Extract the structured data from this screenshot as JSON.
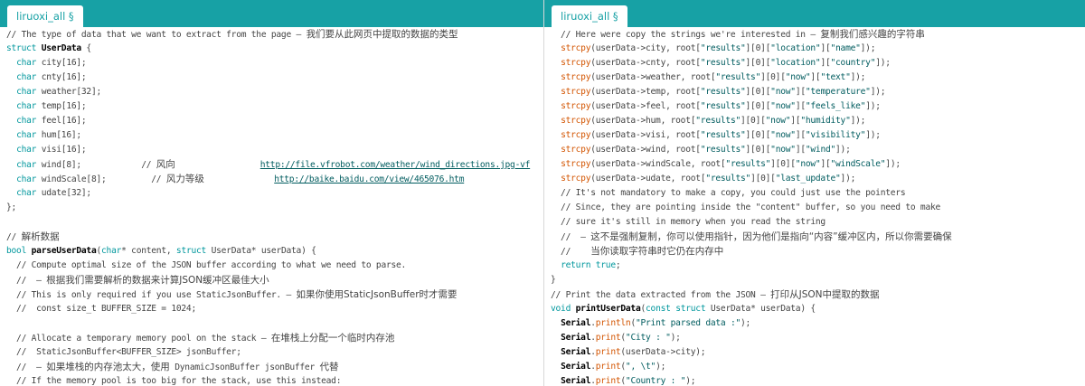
{
  "left_tab": {
    "label": "liruoxi_all §"
  },
  "right_tab": {
    "label": "liruoxi_all §"
  },
  "left_lines": [
    [
      {
        "t": "// The type of data that we want to extract from the page — ",
        "c": "c"
      },
      {
        "t": "我们要从此网页中提取的数据的类型",
        "c": "c cn"
      }
    ],
    [
      {
        "t": "struct",
        "c": "k"
      },
      {
        "t": " ",
        "c": "p"
      },
      {
        "t": "UserData",
        "c": "b"
      },
      {
        "t": " {",
        "c": "p"
      }
    ],
    [
      {
        "t": "  ",
        "c": "p"
      },
      {
        "t": "char",
        "c": "k"
      },
      {
        "t": " city[16];",
        "c": "p"
      }
    ],
    [
      {
        "t": "  ",
        "c": "p"
      },
      {
        "t": "char",
        "c": "k"
      },
      {
        "t": " cnty[16];",
        "c": "p"
      }
    ],
    [
      {
        "t": "  ",
        "c": "p"
      },
      {
        "t": "char",
        "c": "k"
      },
      {
        "t": " weather[32];",
        "c": "p"
      }
    ],
    [
      {
        "t": "  ",
        "c": "p"
      },
      {
        "t": "char",
        "c": "k"
      },
      {
        "t": " temp[16];",
        "c": "p"
      }
    ],
    [
      {
        "t": "  ",
        "c": "p"
      },
      {
        "t": "char",
        "c": "k"
      },
      {
        "t": " feel[16];",
        "c": "p"
      }
    ],
    [
      {
        "t": "  ",
        "c": "p"
      },
      {
        "t": "char",
        "c": "k"
      },
      {
        "t": " hum[16];",
        "c": "p"
      }
    ],
    [
      {
        "t": "  ",
        "c": "p"
      },
      {
        "t": "char",
        "c": "k"
      },
      {
        "t": " visi[16];",
        "c": "p"
      }
    ],
    [
      {
        "t": "  ",
        "c": "p"
      },
      {
        "t": "char",
        "c": "k"
      },
      {
        "t": " wind[8];            // ",
        "c": "p"
      },
      {
        "t": "风向",
        "c": "c cn"
      },
      {
        "t": "                 ",
        "c": "p"
      },
      {
        "t": "http://file.vfrobot.com/weather/wind_directions.jpg-vf",
        "c": "u"
      }
    ],
    [
      {
        "t": "  ",
        "c": "p"
      },
      {
        "t": "char",
        "c": "k"
      },
      {
        "t": " windScale[8];         // ",
        "c": "p"
      },
      {
        "t": "风力等级",
        "c": "c cn"
      },
      {
        "t": "              ",
        "c": "p"
      },
      {
        "t": "http://baike.baidu.com/view/465076.htm",
        "c": "u"
      }
    ],
    [
      {
        "t": "  ",
        "c": "p"
      },
      {
        "t": "char",
        "c": "k"
      },
      {
        "t": " udate[32];",
        "c": "p"
      }
    ],
    [
      {
        "t": "};",
        "c": "p"
      }
    ],
    [
      {
        "t": "",
        "c": "p"
      }
    ],
    [
      {
        "t": "// ",
        "c": "c"
      },
      {
        "t": "解析数据",
        "c": "c cn"
      }
    ],
    [
      {
        "t": "bool",
        "c": "k"
      },
      {
        "t": " ",
        "c": "p"
      },
      {
        "t": "parseUserData",
        "c": "b"
      },
      {
        "t": "(",
        "c": "p"
      },
      {
        "t": "char",
        "c": "k"
      },
      {
        "t": "* content, ",
        "c": "p"
      },
      {
        "t": "struct",
        "c": "k"
      },
      {
        "t": " UserData* userData) {",
        "c": "p"
      }
    ],
    [
      {
        "t": "  // Compute optimal size of the JSON buffer according to what we need to parse.",
        "c": "c"
      }
    ],
    [
      {
        "t": "  //  — ",
        "c": "c"
      },
      {
        "t": "根据我们需要解析的数据来计算JSON缓冲区最佳大小",
        "c": "c cn"
      }
    ],
    [
      {
        "t": "  // This is only required if you use StaticJsonBuffer. — ",
        "c": "c"
      },
      {
        "t": "如果你使用StaticJsonBuffer时才需要",
        "c": "c cn"
      }
    ],
    [
      {
        "t": "  //  const size_t BUFFER_SIZE = 1024;",
        "c": "c"
      }
    ],
    [
      {
        "t": "",
        "c": "p"
      }
    ],
    [
      {
        "t": "  // Allocate a temporary memory pool on the stack — ",
        "c": "c"
      },
      {
        "t": "在堆栈上分配一个临时内存池",
        "c": "c cn"
      }
    ],
    [
      {
        "t": "  //  StaticJsonBuffer<BUFFER_SIZE> jsonBuffer;",
        "c": "c"
      }
    ],
    [
      {
        "t": "  //  — ",
        "c": "c"
      },
      {
        "t": "如果堆栈的内存池太大，使用",
        "c": "c cn"
      },
      {
        "t": " DynamicJsonBuffer jsonBuffer ",
        "c": "c"
      },
      {
        "t": "代替",
        "c": "c cn"
      }
    ],
    [
      {
        "t": "  // If the memory pool is too big for the stack, use this instead:",
        "c": "c"
      }
    ]
  ],
  "right_lines": [
    [
      {
        "t": "  // Here were copy the strings we're interested in — ",
        "c": "c"
      },
      {
        "t": "复制我们感兴趣的字符串",
        "c": "c cn"
      }
    ],
    [
      {
        "t": "  ",
        "c": "p"
      },
      {
        "t": "strcpy",
        "c": "f"
      },
      {
        "t": "(userData->city, root[",
        "c": "p"
      },
      {
        "t": "\"results\"",
        "c": "s"
      },
      {
        "t": "][0][",
        "c": "p"
      },
      {
        "t": "\"location\"",
        "c": "s"
      },
      {
        "t": "][",
        "c": "p"
      },
      {
        "t": "\"name\"",
        "c": "s"
      },
      {
        "t": "]);",
        "c": "p"
      }
    ],
    [
      {
        "t": "  ",
        "c": "p"
      },
      {
        "t": "strcpy",
        "c": "f"
      },
      {
        "t": "(userData->cnty, root[",
        "c": "p"
      },
      {
        "t": "\"results\"",
        "c": "s"
      },
      {
        "t": "][0][",
        "c": "p"
      },
      {
        "t": "\"location\"",
        "c": "s"
      },
      {
        "t": "][",
        "c": "p"
      },
      {
        "t": "\"country\"",
        "c": "s"
      },
      {
        "t": "]);",
        "c": "p"
      }
    ],
    [
      {
        "t": "  ",
        "c": "p"
      },
      {
        "t": "strcpy",
        "c": "f"
      },
      {
        "t": "(userData->weather, root[",
        "c": "p"
      },
      {
        "t": "\"results\"",
        "c": "s"
      },
      {
        "t": "][0][",
        "c": "p"
      },
      {
        "t": "\"now\"",
        "c": "s"
      },
      {
        "t": "][",
        "c": "p"
      },
      {
        "t": "\"text\"",
        "c": "s"
      },
      {
        "t": "]);",
        "c": "p"
      }
    ],
    [
      {
        "t": "  ",
        "c": "p"
      },
      {
        "t": "strcpy",
        "c": "f"
      },
      {
        "t": "(userData->temp, root[",
        "c": "p"
      },
      {
        "t": "\"results\"",
        "c": "s"
      },
      {
        "t": "][0][",
        "c": "p"
      },
      {
        "t": "\"now\"",
        "c": "s"
      },
      {
        "t": "][",
        "c": "p"
      },
      {
        "t": "\"temperature\"",
        "c": "s"
      },
      {
        "t": "]);",
        "c": "p"
      }
    ],
    [
      {
        "t": "  ",
        "c": "p"
      },
      {
        "t": "strcpy",
        "c": "f"
      },
      {
        "t": "(userData->feel, root[",
        "c": "p"
      },
      {
        "t": "\"results\"",
        "c": "s"
      },
      {
        "t": "][0][",
        "c": "p"
      },
      {
        "t": "\"now\"",
        "c": "s"
      },
      {
        "t": "][",
        "c": "p"
      },
      {
        "t": "\"feels_like\"",
        "c": "s"
      },
      {
        "t": "]);",
        "c": "p"
      }
    ],
    [
      {
        "t": "  ",
        "c": "p"
      },
      {
        "t": "strcpy",
        "c": "f"
      },
      {
        "t": "(userData->hum, root[",
        "c": "p"
      },
      {
        "t": "\"results\"",
        "c": "s"
      },
      {
        "t": "][0][",
        "c": "p"
      },
      {
        "t": "\"now\"",
        "c": "s"
      },
      {
        "t": "][",
        "c": "p"
      },
      {
        "t": "\"humidity\"",
        "c": "s"
      },
      {
        "t": "]);",
        "c": "p"
      }
    ],
    [
      {
        "t": "  ",
        "c": "p"
      },
      {
        "t": "strcpy",
        "c": "f"
      },
      {
        "t": "(userData->visi, root[",
        "c": "p"
      },
      {
        "t": "\"results\"",
        "c": "s"
      },
      {
        "t": "][0][",
        "c": "p"
      },
      {
        "t": "\"now\"",
        "c": "s"
      },
      {
        "t": "][",
        "c": "p"
      },
      {
        "t": "\"visibility\"",
        "c": "s"
      },
      {
        "t": "]);",
        "c": "p"
      }
    ],
    [
      {
        "t": "  ",
        "c": "p"
      },
      {
        "t": "strcpy",
        "c": "f"
      },
      {
        "t": "(userData->wind, root[",
        "c": "p"
      },
      {
        "t": "\"results\"",
        "c": "s"
      },
      {
        "t": "][0][",
        "c": "p"
      },
      {
        "t": "\"now\"",
        "c": "s"
      },
      {
        "t": "][",
        "c": "p"
      },
      {
        "t": "\"wind\"",
        "c": "s"
      },
      {
        "t": "]);",
        "c": "p"
      }
    ],
    [
      {
        "t": "  ",
        "c": "p"
      },
      {
        "t": "strcpy",
        "c": "f"
      },
      {
        "t": "(userData->windScale, root[",
        "c": "p"
      },
      {
        "t": "\"results\"",
        "c": "s"
      },
      {
        "t": "][0][",
        "c": "p"
      },
      {
        "t": "\"now\"",
        "c": "s"
      },
      {
        "t": "][",
        "c": "p"
      },
      {
        "t": "\"windScale\"",
        "c": "s"
      },
      {
        "t": "]);",
        "c": "p"
      }
    ],
    [
      {
        "t": "  ",
        "c": "p"
      },
      {
        "t": "strcpy",
        "c": "f"
      },
      {
        "t": "(userData->udate, root[",
        "c": "p"
      },
      {
        "t": "\"results\"",
        "c": "s"
      },
      {
        "t": "][0][",
        "c": "p"
      },
      {
        "t": "\"last_update\"",
        "c": "s"
      },
      {
        "t": "]);",
        "c": "p"
      }
    ],
    [
      {
        "t": "  // It's not mandatory to make a copy, you could just use the pointers",
        "c": "c"
      }
    ],
    [
      {
        "t": "  // Since, they are pointing inside the \"content\" buffer, so you need to make",
        "c": "c"
      }
    ],
    [
      {
        "t": "  // sure it's still in memory when you read the string",
        "c": "c"
      }
    ],
    [
      {
        "t": "  //  — ",
        "c": "c"
      },
      {
        "t": "这不是强制复制，你可以使用指针，因为他们是指向“内容”缓冲区内，所以你需要确保",
        "c": "c cn"
      }
    ],
    [
      {
        "t": "  //    ",
        "c": "c"
      },
      {
        "t": "当你读取字符串时它仍在内存中",
        "c": "c cn"
      }
    ],
    [
      {
        "t": "  ",
        "c": "p"
      },
      {
        "t": "return",
        "c": "k"
      },
      {
        "t": " ",
        "c": "p"
      },
      {
        "t": "true",
        "c": "k"
      },
      {
        "t": ";",
        "c": "p"
      }
    ],
    [
      {
        "t": "}",
        "c": "p"
      }
    ],
    [
      {
        "t": "// Print the data extracted from the JSON — ",
        "c": "c"
      },
      {
        "t": "打印从JSON中提取的数据",
        "c": "c cn"
      }
    ],
    [
      {
        "t": "void",
        "c": "k"
      },
      {
        "t": " ",
        "c": "p"
      },
      {
        "t": "printUserData",
        "c": "b"
      },
      {
        "t": "(",
        "c": "p"
      },
      {
        "t": "const",
        "c": "k"
      },
      {
        "t": " ",
        "c": "p"
      },
      {
        "t": "struct",
        "c": "k"
      },
      {
        "t": " UserData* userData) {",
        "c": "p"
      }
    ],
    [
      {
        "t": "  ",
        "c": "p"
      },
      {
        "t": "Serial",
        "c": "f b"
      },
      {
        "t": ".",
        "c": "p"
      },
      {
        "t": "println",
        "c": "f"
      },
      {
        "t": "(",
        "c": "p"
      },
      {
        "t": "\"Print parsed data :\"",
        "c": "s"
      },
      {
        "t": ");",
        "c": "p"
      }
    ],
    [
      {
        "t": "  ",
        "c": "p"
      },
      {
        "t": "Serial",
        "c": "f b"
      },
      {
        "t": ".",
        "c": "p"
      },
      {
        "t": "print",
        "c": "f"
      },
      {
        "t": "(",
        "c": "p"
      },
      {
        "t": "\"City : \"",
        "c": "s"
      },
      {
        "t": ");",
        "c": "p"
      }
    ],
    [
      {
        "t": "  ",
        "c": "p"
      },
      {
        "t": "Serial",
        "c": "f b"
      },
      {
        "t": ".",
        "c": "p"
      },
      {
        "t": "print",
        "c": "f"
      },
      {
        "t": "(userData->city);",
        "c": "p"
      }
    ],
    [
      {
        "t": "  ",
        "c": "p"
      },
      {
        "t": "Serial",
        "c": "f b"
      },
      {
        "t": ".",
        "c": "p"
      },
      {
        "t": "print",
        "c": "f"
      },
      {
        "t": "(",
        "c": "p"
      },
      {
        "t": "\", \\t\"",
        "c": "s"
      },
      {
        "t": ");",
        "c": "p"
      }
    ],
    [
      {
        "t": "  ",
        "c": "p"
      },
      {
        "t": "Serial",
        "c": "f b"
      },
      {
        "t": ".",
        "c": "p"
      },
      {
        "t": "print",
        "c": "f"
      },
      {
        "t": "(",
        "c": "p"
      },
      {
        "t": "\"Country : \"",
        "c": "s"
      },
      {
        "t": ");",
        "c": "p"
      }
    ]
  ]
}
